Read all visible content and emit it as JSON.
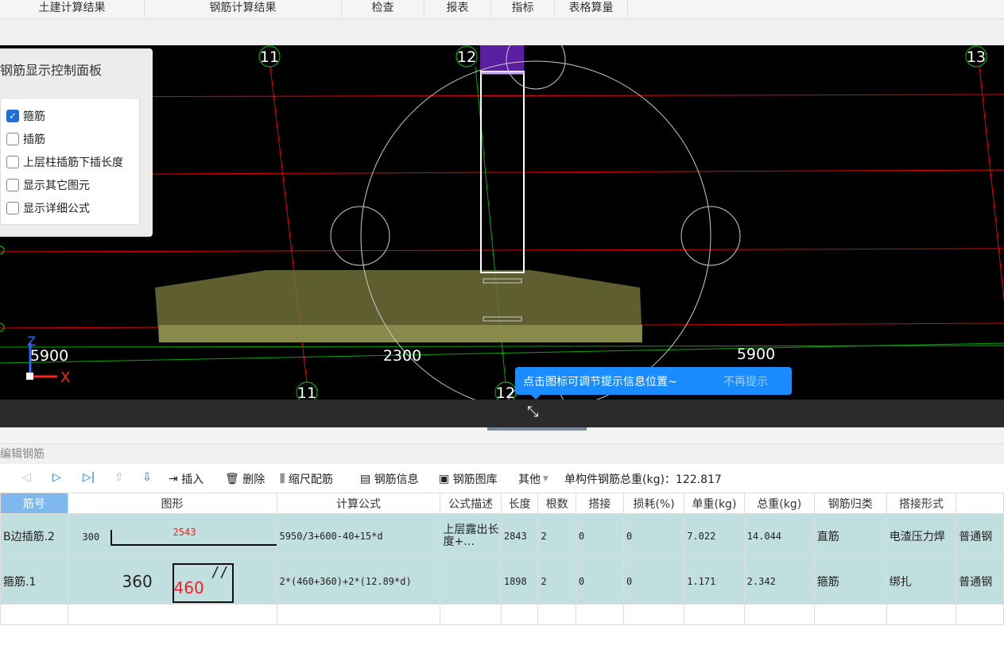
{
  "menu": [
    "土建计算结果",
    "钢筋计算结果",
    "检查",
    "报表",
    "指标",
    "表格算量"
  ],
  "viewport": {
    "axis_top": [
      "11",
      "12",
      "13"
    ],
    "axis_bottom": [
      "11",
      "12"
    ],
    "dims": [
      "5900",
      "2300",
      "5900"
    ],
    "axis_x": "X",
    "axis_z": "Z"
  },
  "panel": {
    "title": "钢筋显示控制面板",
    "options": [
      {
        "label": "箍筋",
        "checked": true
      },
      {
        "label": "插筋",
        "checked": false
      },
      {
        "label": "上层柱插筋下插长度",
        "checked": false
      },
      {
        "label": "显示其它图元",
        "checked": false
      },
      {
        "label": "显示详细公式",
        "checked": false
      }
    ]
  },
  "tip": {
    "text": "点击图标可调节提示信息位置~",
    "dismiss": "不再提示"
  },
  "section": "编辑钢筋",
  "toolbar": {
    "insert": "插入",
    "delete": "删除",
    "scale": "缩尺配筋",
    "info": "钢筋信息",
    "library": "钢筋图库",
    "other": "其他",
    "total_label": "单构件钢筋总重(kg)：122.817"
  },
  "table": {
    "headers": [
      "筋号",
      "图形",
      "计算公式",
      "公式描述",
      "长度",
      "根数",
      "搭接",
      "损耗(%)",
      "单重(kg)",
      "总重(kg)",
      "钢筋归类",
      "搭接形式",
      ""
    ],
    "rows": [
      {
        "name": "B边插筋.2",
        "shape": {
          "left": "300",
          "mid": "2543"
        },
        "formula": "5950/3+600-40+15*d",
        "desc": "上层露出长度+…",
        "length": "2843",
        "count": "2",
        "lap": "0",
        "loss": "0",
        "unit": "7.022",
        "total": "14.044",
        "cat": "直筋",
        "lap_type": "电渣压力焊",
        "kind": "普通钢"
      },
      {
        "name": "箍筋.1",
        "shape": {
          "left": "360",
          "mid": "460"
        },
        "formula": "2*(460+360)+2*(12.89*d)",
        "desc": "",
        "length": "1898",
        "count": "2",
        "lap": "0",
        "loss": "0",
        "unit": "1.171",
        "total": "2.342",
        "cat": "箍筋",
        "lap_type": "绑扎",
        "kind": "普通钢"
      }
    ]
  }
}
